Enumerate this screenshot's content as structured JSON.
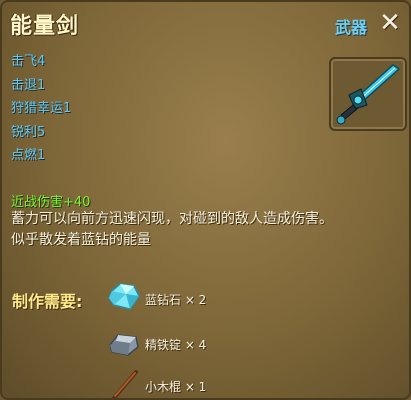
{
  "item": {
    "title": "能量剑",
    "category": "武器",
    "close_label": "✕"
  },
  "attributes": [
    {
      "label": "击飞4"
    },
    {
      "label": "击退1"
    },
    {
      "label": "狩猎幸运1"
    },
    {
      "label": "锐利5"
    },
    {
      "label": "点燃1"
    }
  ],
  "melee_damage": "近战伤害+40",
  "description": "蓄力可以向前方迅速闪现，对碰到的敌人造成伤害。似乎散发着蓝钻的能量",
  "crafting": {
    "label": "制作需要:",
    "materials": [
      {
        "name": "蓝钻石 × 2",
        "icon": "blue-diamond-icon"
      },
      {
        "name": "精铁锭 × 4",
        "icon": "iron-ingot-icon"
      },
      {
        "name": "小木棍 × 1",
        "icon": "wooden-stick-icon"
      }
    ]
  },
  "colors": {
    "attribute_text": "#5fc9f0",
    "melee_text": "#7ff22c",
    "title_text": "#fff7c8",
    "craft_label": "#ffea88"
  }
}
